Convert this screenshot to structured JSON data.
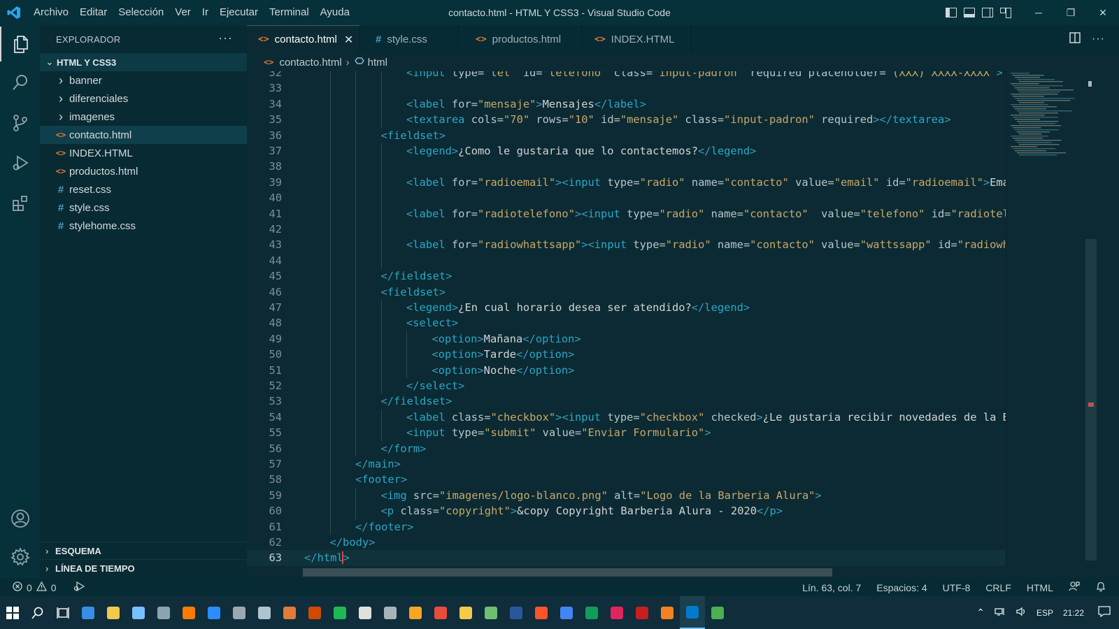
{
  "titlebar": {
    "menu": [
      "Archivo",
      "Editar",
      "Selección",
      "Ver",
      "Ir",
      "Ejecutar",
      "Terminal",
      "Ayuda"
    ],
    "title": "contacto.html - HTML Y CSS3 - Visual Studio Code",
    "minimize": "─",
    "maximize": "❐",
    "close": "✕"
  },
  "sidebar": {
    "header": "EXPLORADOR",
    "more": "···",
    "folder": "HTML Y CSS3",
    "items": [
      {
        "label": "banner",
        "kind": "folder"
      },
      {
        "label": "diferenciales",
        "kind": "folder"
      },
      {
        "label": "imagenes",
        "kind": "folder"
      },
      {
        "label": "contacto.html",
        "kind": "html",
        "selected": true
      },
      {
        "label": "INDEX.HTML",
        "kind": "html"
      },
      {
        "label": "productos.html",
        "kind": "html"
      },
      {
        "label": "reset.css",
        "kind": "css"
      },
      {
        "label": "style.css",
        "kind": "css"
      },
      {
        "label": "stylehome.css",
        "kind": "css"
      }
    ],
    "outline": "ESQUEMA",
    "timeline": "LÍNEA DE TIEMPO"
  },
  "tabs": [
    {
      "label": "contacto.html",
      "kind": "html",
      "active": true
    },
    {
      "label": "style.css",
      "kind": "css"
    },
    {
      "label": "productos.html",
      "kind": "html"
    },
    {
      "label": "INDEX.HTML",
      "kind": "html"
    }
  ],
  "breadcrumb": {
    "file": "contacto.html",
    "node": "html"
  },
  "editor": {
    "cursor_line": 63,
    "lines": [
      {
        "n": 32,
        "indent": 4,
        "parts": [
          [
            "t",
            "<"
          ],
          [
            "tn",
            "input"
          ],
          [
            "an",
            " type="
          ],
          [
            "av",
            "\"tel\""
          ],
          [
            "an",
            " id="
          ],
          [
            "av",
            "\"telefono\""
          ],
          [
            "an",
            " class="
          ],
          [
            "av",
            "\"input-padron\""
          ],
          [
            "an",
            " required placeholder="
          ],
          [
            "av",
            "\"(XXX) XXXX-XXXX\""
          ],
          [
            "t",
            ">"
          ]
        ]
      },
      {
        "n": 33,
        "indent": 0,
        "parts": []
      },
      {
        "n": 34,
        "indent": 4,
        "parts": [
          [
            "t",
            "<"
          ],
          [
            "tn",
            "label"
          ],
          [
            "an",
            " for="
          ],
          [
            "av",
            "\"mensaje\""
          ],
          [
            "t",
            ">"
          ],
          [
            "tx",
            "Mensajes"
          ],
          [
            "t",
            "</"
          ],
          [
            "tn",
            "label"
          ],
          [
            "t",
            ">"
          ]
        ]
      },
      {
        "n": 35,
        "indent": 4,
        "parts": [
          [
            "t",
            "<"
          ],
          [
            "tn",
            "textarea"
          ],
          [
            "an",
            " cols="
          ],
          [
            "av",
            "\"70\""
          ],
          [
            "an",
            " rows="
          ],
          [
            "av",
            "\"10\""
          ],
          [
            "an",
            " id="
          ],
          [
            "av",
            "\"mensaje\""
          ],
          [
            "an",
            " class="
          ],
          [
            "av",
            "\"input-padron\""
          ],
          [
            "an",
            " required"
          ],
          [
            "t",
            "></"
          ],
          [
            "tn",
            "textarea"
          ],
          [
            "t",
            ">"
          ]
        ]
      },
      {
        "n": 36,
        "indent": 3,
        "parts": [
          [
            "t",
            "<"
          ],
          [
            "tn",
            "fieldset"
          ],
          [
            "t",
            ">"
          ]
        ]
      },
      {
        "n": 37,
        "indent": 4,
        "parts": [
          [
            "t",
            "<"
          ],
          [
            "tn",
            "legend"
          ],
          [
            "t",
            ">"
          ],
          [
            "tx",
            "¿Como le gustaria que lo contactemos?"
          ],
          [
            "t",
            "</"
          ],
          [
            "tn",
            "legend"
          ],
          [
            "t",
            ">"
          ]
        ]
      },
      {
        "n": 38,
        "indent": 0,
        "parts": []
      },
      {
        "n": 39,
        "indent": 4,
        "parts": [
          [
            "t",
            "<"
          ],
          [
            "tn",
            "label"
          ],
          [
            "an",
            " for="
          ],
          [
            "av",
            "\"radioemail\""
          ],
          [
            "t",
            "><"
          ],
          [
            "tn",
            "input"
          ],
          [
            "an",
            " type="
          ],
          [
            "av",
            "\"radio\""
          ],
          [
            "an",
            " name="
          ],
          [
            "av",
            "\"contacto\""
          ],
          [
            "an",
            " value="
          ],
          [
            "av",
            "\"email\""
          ],
          [
            "an",
            " id="
          ],
          [
            "av",
            "\"radioemail\""
          ],
          [
            "t",
            ">"
          ],
          [
            "tx",
            "Email"
          ]
        ]
      },
      {
        "n": 40,
        "indent": 0,
        "parts": []
      },
      {
        "n": 41,
        "indent": 4,
        "parts": [
          [
            "t",
            "<"
          ],
          [
            "tn",
            "label"
          ],
          [
            "an",
            " for="
          ],
          [
            "av",
            "\"radiotelefono\""
          ],
          [
            "t",
            "><"
          ],
          [
            "tn",
            "input"
          ],
          [
            "an",
            " type="
          ],
          [
            "av",
            "\"radio\""
          ],
          [
            "an",
            " name="
          ],
          [
            "av",
            "\"contacto\""
          ],
          [
            "an",
            "  value="
          ],
          [
            "av",
            "\"telefono\""
          ],
          [
            "an",
            " id="
          ],
          [
            "av",
            "\"radiotelefono\""
          ]
        ]
      },
      {
        "n": 42,
        "indent": 0,
        "parts": []
      },
      {
        "n": 43,
        "indent": 4,
        "parts": [
          [
            "t",
            "<"
          ],
          [
            "tn",
            "label"
          ],
          [
            "an",
            " for="
          ],
          [
            "av",
            "\"radiowhattsapp\""
          ],
          [
            "t",
            "><"
          ],
          [
            "tn",
            "input"
          ],
          [
            "an",
            " type="
          ],
          [
            "av",
            "\"radio\""
          ],
          [
            "an",
            " name="
          ],
          [
            "av",
            "\"contacto\""
          ],
          [
            "an",
            " value="
          ],
          [
            "av",
            "\"wattssapp\""
          ],
          [
            "an",
            " id="
          ],
          [
            "av",
            "\"radiowhattsapp\""
          ]
        ]
      },
      {
        "n": 44,
        "indent": 0,
        "parts": []
      },
      {
        "n": 45,
        "indent": 3,
        "parts": [
          [
            "t",
            "</"
          ],
          [
            "tn",
            "fieldset"
          ],
          [
            "t",
            ">"
          ]
        ]
      },
      {
        "n": 46,
        "indent": 3,
        "parts": [
          [
            "t",
            "<"
          ],
          [
            "tn",
            "fieldset"
          ],
          [
            "t",
            ">"
          ]
        ]
      },
      {
        "n": 47,
        "indent": 4,
        "parts": [
          [
            "t",
            "<"
          ],
          [
            "tn",
            "legend"
          ],
          [
            "t",
            ">"
          ],
          [
            "tx",
            "¿En cual horario desea ser atendido?"
          ],
          [
            "t",
            "</"
          ],
          [
            "tn",
            "legend"
          ],
          [
            "t",
            ">"
          ]
        ]
      },
      {
        "n": 48,
        "indent": 4,
        "parts": [
          [
            "t",
            "<"
          ],
          [
            "tn",
            "select"
          ],
          [
            "t",
            ">"
          ]
        ]
      },
      {
        "n": 49,
        "indent": 5,
        "parts": [
          [
            "t",
            "<"
          ],
          [
            "tn",
            "option"
          ],
          [
            "t",
            ">"
          ],
          [
            "tx",
            "Mañana"
          ],
          [
            "t",
            "</"
          ],
          [
            "tn",
            "option"
          ],
          [
            "t",
            ">"
          ]
        ]
      },
      {
        "n": 50,
        "indent": 5,
        "parts": [
          [
            "t",
            "<"
          ],
          [
            "tn",
            "option"
          ],
          [
            "t",
            ">"
          ],
          [
            "tx",
            "Tarde"
          ],
          [
            "t",
            "</"
          ],
          [
            "tn",
            "option"
          ],
          [
            "t",
            ">"
          ]
        ]
      },
      {
        "n": 51,
        "indent": 5,
        "parts": [
          [
            "t",
            "<"
          ],
          [
            "tn",
            "option"
          ],
          [
            "t",
            ">"
          ],
          [
            "tx",
            "Noche"
          ],
          [
            "t",
            "</"
          ],
          [
            "tn",
            "option"
          ],
          [
            "t",
            ">"
          ]
        ]
      },
      {
        "n": 52,
        "indent": 4,
        "parts": [
          [
            "t",
            "</"
          ],
          [
            "tn",
            "select"
          ],
          [
            "t",
            ">"
          ]
        ]
      },
      {
        "n": 53,
        "indent": 3,
        "parts": [
          [
            "t",
            "</"
          ],
          [
            "tn",
            "fieldset"
          ],
          [
            "t",
            ">"
          ]
        ]
      },
      {
        "n": 54,
        "indent": 4,
        "parts": [
          [
            "t",
            "<"
          ],
          [
            "tn",
            "label"
          ],
          [
            "an",
            " class="
          ],
          [
            "av",
            "\"checkbox\""
          ],
          [
            "t",
            "><"
          ],
          [
            "tn",
            "input"
          ],
          [
            "an",
            " type="
          ],
          [
            "av",
            "\"checkbox\""
          ],
          [
            "an",
            " checked"
          ],
          [
            "t",
            ">"
          ],
          [
            "tx",
            "¿Le gustaria recibir novedades de la Barberia Alura?"
          ]
        ]
      },
      {
        "n": 55,
        "indent": 4,
        "parts": [
          [
            "t",
            "<"
          ],
          [
            "tn",
            "input"
          ],
          [
            "an",
            " type="
          ],
          [
            "av",
            "\"submit\""
          ],
          [
            "an",
            " value="
          ],
          [
            "av",
            "\"Enviar Formulario\""
          ],
          [
            "t",
            ">"
          ]
        ]
      },
      {
        "n": 56,
        "indent": 3,
        "parts": [
          [
            "t",
            "</"
          ],
          [
            "tn",
            "form"
          ],
          [
            "t",
            ">"
          ]
        ]
      },
      {
        "n": 57,
        "indent": 2,
        "parts": [
          [
            "t",
            "</"
          ],
          [
            "tn",
            "main"
          ],
          [
            "t",
            ">"
          ]
        ]
      },
      {
        "n": 58,
        "indent": 2,
        "parts": [
          [
            "t",
            "<"
          ],
          [
            "tn",
            "footer"
          ],
          [
            "t",
            ">"
          ]
        ]
      },
      {
        "n": 59,
        "indent": 3,
        "parts": [
          [
            "t",
            "<"
          ],
          [
            "tn",
            "img"
          ],
          [
            "an",
            " src="
          ],
          [
            "av",
            "\"imagenes/logo-blanco.png\""
          ],
          [
            "an",
            " alt="
          ],
          [
            "av",
            "\"Logo de la Barberia Alura\""
          ],
          [
            "t",
            ">"
          ]
        ]
      },
      {
        "n": 60,
        "indent": 3,
        "parts": [
          [
            "t",
            "<"
          ],
          [
            "tn",
            "p"
          ],
          [
            "an",
            " class="
          ],
          [
            "av",
            "\"copyright\""
          ],
          [
            "t",
            ">"
          ],
          [
            "tx",
            "&copy Copyright Barberia Alura - 2020"
          ],
          [
            "t",
            "</"
          ],
          [
            "tn",
            "p"
          ],
          [
            "t",
            ">"
          ]
        ]
      },
      {
        "n": 61,
        "indent": 2,
        "parts": [
          [
            "t",
            "</"
          ],
          [
            "tn",
            "footer"
          ],
          [
            "t",
            ">"
          ]
        ]
      },
      {
        "n": 62,
        "indent": 1,
        "parts": [
          [
            "t",
            "</"
          ],
          [
            "tn",
            "body"
          ],
          [
            "t",
            ">"
          ]
        ]
      },
      {
        "n": 63,
        "indent": 0,
        "parts": [
          [
            "t",
            "</"
          ],
          [
            "tn",
            "html"
          ],
          [
            "t",
            ">"
          ]
        ]
      }
    ]
  },
  "statusbar": {
    "errors": "0",
    "warnings": "0",
    "position": "Lín. 63, col. 7",
    "spaces": "Espacios: 4",
    "encoding": "UTF-8",
    "eol": "CRLF",
    "language": "HTML"
  },
  "taskbar": {
    "lang": "ESP",
    "time": "21:22",
    "apps": [
      "#3a8ee6",
      "#f2c94c",
      "#79c0ff",
      "#8aa4b0",
      "#ff7a00",
      "#2d8cff",
      "#9aa9b0",
      "#b0c4d0",
      "#e07b39",
      "#d04a02",
      "#1db954",
      "#e0e0e0",
      "#a7b3b8",
      "#f5a623",
      "#e74c3c",
      "#f7c948",
      "#6fbf73",
      "#2b579a",
      "#fb542b",
      "#4285f4",
      "#0f9d58",
      "#e0245e",
      "#c81e1e",
      "#f58220",
      "#007acc",
      "#4caf50"
    ]
  },
  "colors": {
    "accent": "#007acc",
    "html_icon": "#e37933",
    "css_icon": "#519aba"
  }
}
